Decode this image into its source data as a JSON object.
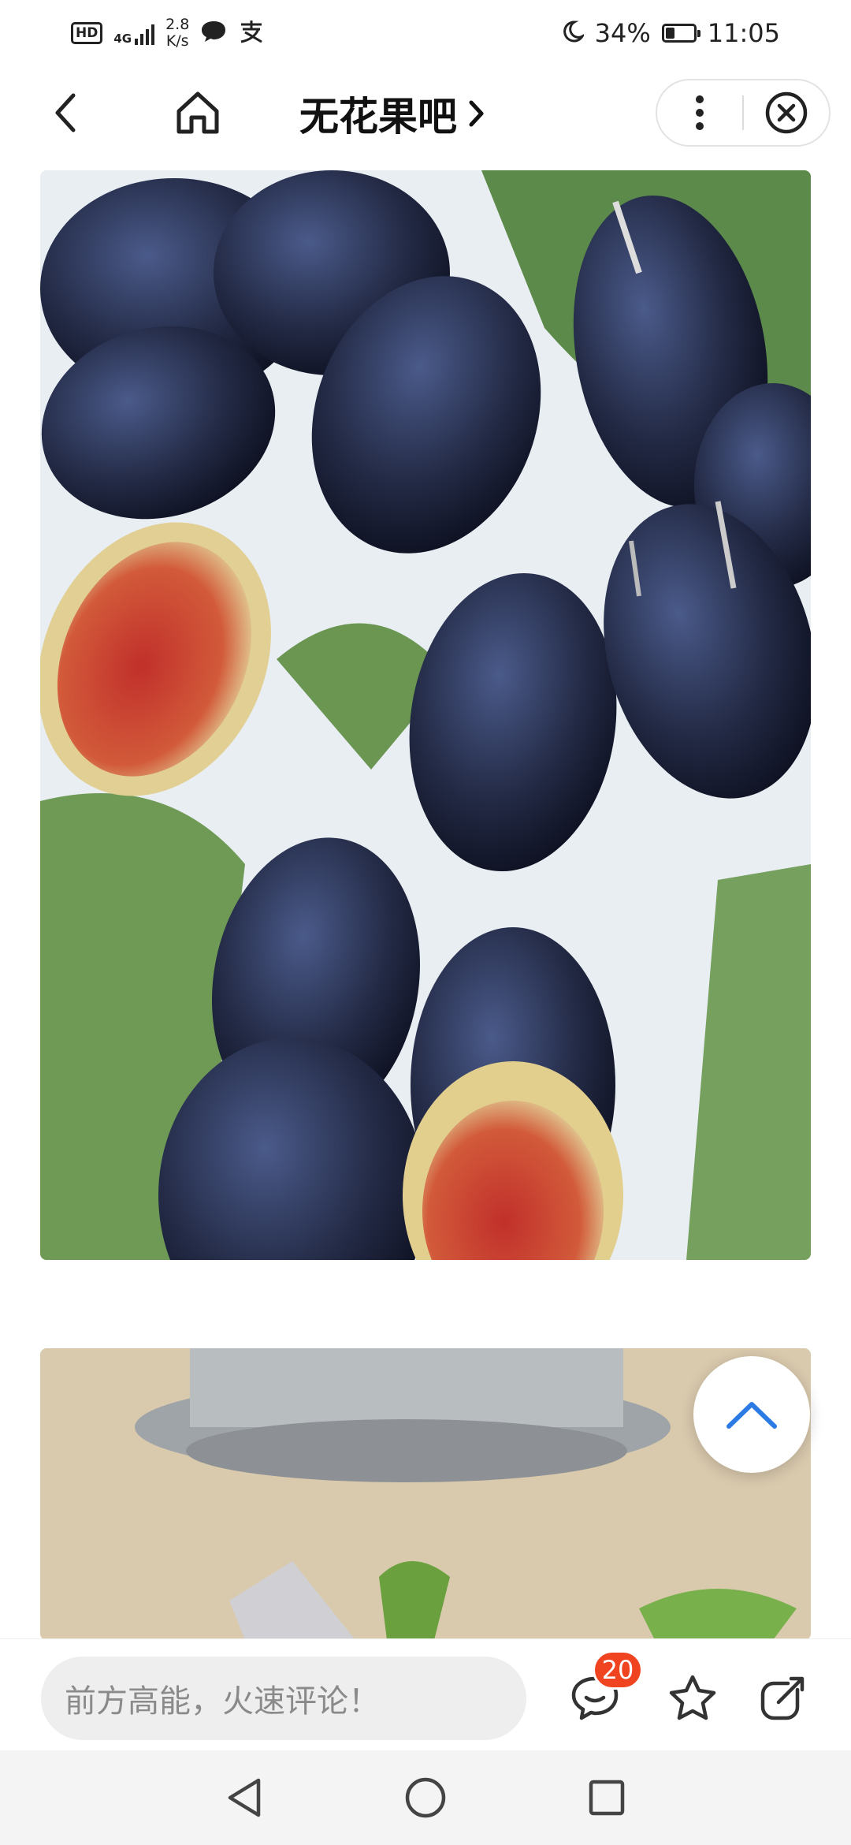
{
  "status_bar": {
    "hd": "HD",
    "network": "4G",
    "speed_value": "2.8",
    "speed_unit": "K/s",
    "battery_percent": "34%",
    "battery_level": 0.34,
    "time": "11:05"
  },
  "header": {
    "title": "无花果吧",
    "title_chevron": "›"
  },
  "comment_bar": {
    "placeholder": "前方高能，火速评论！",
    "comment_count": "20"
  },
  "colors": {
    "accent_blue": "#2c7be5",
    "badge_red": "#f0431f"
  }
}
